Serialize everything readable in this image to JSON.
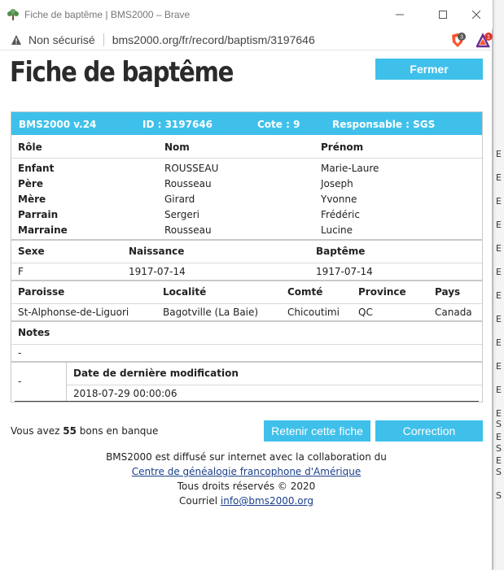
{
  "window": {
    "title": "Fiche de baptême | BMS2000 – Brave",
    "insecure_label": "Non sécurisé",
    "url": "bms2000.org/fr/record/baptism/3197646",
    "shield_count": "3",
    "rewards_count": "1"
  },
  "page": {
    "title": "Fiche de baptême",
    "close_button": "Fermer"
  },
  "record_header": {
    "version": "BMS2000 v.24",
    "id": "ID : 3197646",
    "cote": "Cote : 9",
    "responsable": "Responsable : SGS"
  },
  "persons": {
    "columns": [
      "Rôle",
      "Nom",
      "Prénom"
    ],
    "rows": [
      {
        "role": "Enfant",
        "nom": "ROUSSEAU",
        "prenom": "Marie-Laure"
      },
      {
        "role": "Père",
        "nom": "Rousseau",
        "prenom": "Joseph"
      },
      {
        "role": "Mère",
        "nom": "Girard",
        "prenom": "Yvonne"
      },
      {
        "role": "Parrain",
        "nom": "Sergeri",
        "prenom": "Frédéric"
      },
      {
        "role": "Marraine",
        "nom": "Rousseau",
        "prenom": "Lucine"
      }
    ]
  },
  "vitals": {
    "columns": [
      "Sexe",
      "Naissance",
      "Baptême"
    ],
    "values": [
      "F",
      "1917-07-14",
      "1917-07-14"
    ]
  },
  "location": {
    "columns": [
      "Paroisse",
      "Localité",
      "Comté",
      "Province",
      "Pays"
    ],
    "values": [
      "St-Alphonse-de-Liguori",
      "Bagotville (La Baie)",
      "Chicoutimi",
      "QC",
      "Canada"
    ]
  },
  "notes": {
    "label": "Notes",
    "value": "-"
  },
  "modification": {
    "left_value": "-",
    "label": "Date de dernière modification",
    "value": "2018-07-29 00:00:06"
  },
  "bank": {
    "prefix": "Vous avez",
    "count": "55",
    "suffix": "bons en banque"
  },
  "actions": {
    "keep": "Retenir cette fiche",
    "correct": "Correction"
  },
  "footer": {
    "line1": "BMS2000 est diffusé sur internet avec la collaboration du",
    "partner_link": "Centre de généalogie francophone d'Amérique",
    "rights": "Tous droits réservés © 2020",
    "mail_prefix": "Courriel",
    "mail_link": "info@bms2000.org"
  },
  "background_letters": [
    "E",
    "E",
    "E",
    "E",
    "E",
    "E",
    "E",
    "E",
    "E",
    "E",
    "E",
    "E",
    "E",
    "E",
    "S",
    "S",
    "S",
    "S"
  ],
  "colors": {
    "accent": "#3fc0ea",
    "brave_orange": "#fb542b",
    "rewards_purple": "#662d91"
  }
}
